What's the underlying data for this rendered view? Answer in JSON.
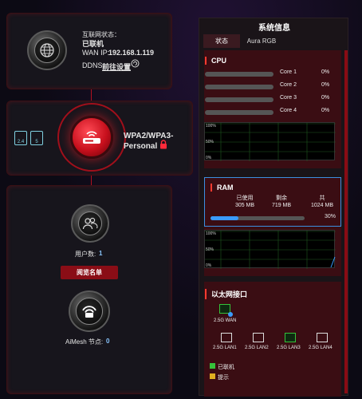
{
  "internet": {
    "status_label": "互联网状态：",
    "status_value": "已联机",
    "wan_ip_label": "WAN IP:",
    "wan_ip_value": "192.168.1.119",
    "ddns_label": "DDNS:",
    "ddns_link": "前往设置"
  },
  "wifi": {
    "band_24": "2.4",
    "band_5": "5",
    "security_line1": "WPA2/WPA3-",
    "security_line2": "Personal"
  },
  "clients": {
    "count_label": "用户数:",
    "count_value": "1",
    "view_list_button": "阅览名单",
    "aimesh_label": "AiMesh 节点:",
    "aimesh_value": "0"
  },
  "system_panel": {
    "title": "系统信息",
    "tabs": [
      "状态",
      "Aura RGB"
    ],
    "cpu": {
      "heading": "CPU",
      "cores": [
        {
          "label": "Core 1",
          "value": "0%",
          "fill": 0
        },
        {
          "label": "Core 2",
          "value": "0%",
          "fill": 0
        },
        {
          "label": "Core 3",
          "value": "0%",
          "fill": 0
        },
        {
          "label": "Core 4",
          "value": "0%",
          "fill": 0
        }
      ],
      "graph_labels": [
        "100%",
        "50%",
        "0%"
      ]
    },
    "ram": {
      "heading": "RAM",
      "used_label": "已使用",
      "used_value": "305 MB",
      "free_label": "剩余",
      "free_value": "719 MB",
      "total_label": "共",
      "total_value": "1024 MB",
      "percent": "30%",
      "fill": 0.3,
      "graph_labels": [
        "100%",
        "50%",
        "0%"
      ]
    },
    "ethernet": {
      "heading": "以太网接口",
      "wan_label": "2.5G WAN",
      "lans": [
        {
          "label": "2.5G LAN1",
          "connected": false
        },
        {
          "label": "2.5G LAN2",
          "connected": false
        },
        {
          "label": "2.5G LAN3",
          "connected": true
        },
        {
          "label": "2.5G LAN4",
          "connected": false
        }
      ],
      "legend": [
        {
          "label": "已联机",
          "color": "#35c23a"
        },
        {
          "label": "提示",
          "color": "#e0b020"
        }
      ]
    }
  }
}
